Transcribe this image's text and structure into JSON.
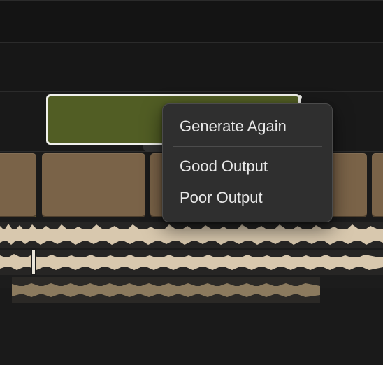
{
  "context_menu": {
    "items": [
      {
        "label": "Generate Again"
      },
      {
        "label": "Good Output"
      },
      {
        "label": "Poor Output"
      }
    ]
  },
  "colors": {
    "selected_clip": "#515d24",
    "selected_border": "#f0f0ec",
    "brown_clip": "#7a6348",
    "olive_small": "#7c7a2e",
    "waveform": "#d8c8ae",
    "menu_bg": "#2f2f2f",
    "menu_text": "#e8e8e8"
  },
  "icons": {
    "clip_handle": "clip-handle-icon"
  }
}
